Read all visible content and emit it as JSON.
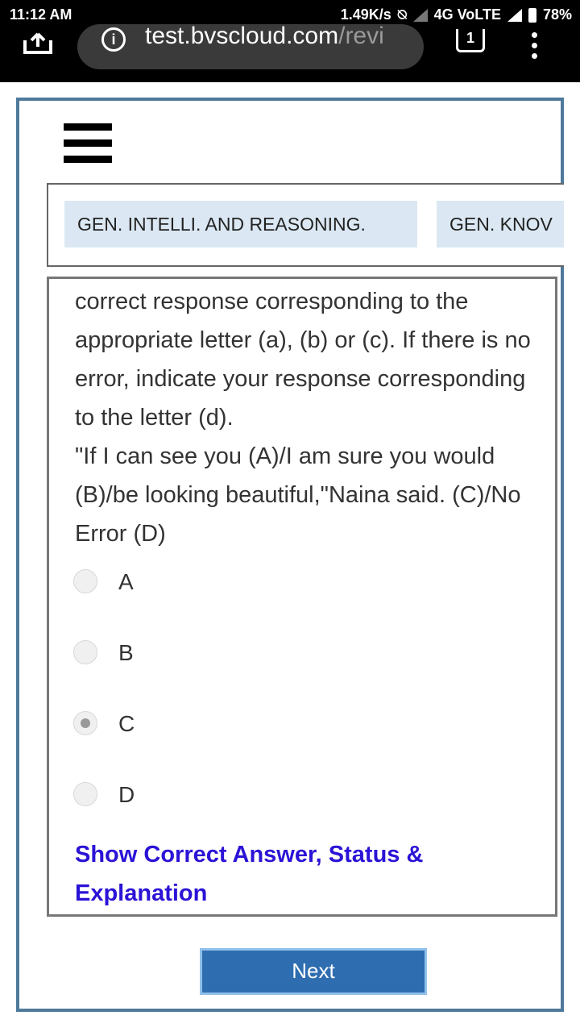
{
  "status_bar": {
    "time": "11:12 AM",
    "net_speed": "1.49K/s",
    "network": "4G VoLTE",
    "battery": "78%"
  },
  "browser": {
    "url_main": "test.bvscloud.com",
    "url_faded": "/revi",
    "tab_count": "1"
  },
  "section_tabs": [
    {
      "label": "GEN. INTELLI. AND REASONING."
    },
    {
      "label": "GEN. KNOV"
    }
  ],
  "question": {
    "text": "correct response corresponding to the appropriate letter (a), (b) or (c). If there is no error, indicate your response corresponding to the letter (d).\n\"If I can see you (A)/I am sure you would (B)/be looking beautiful,\"Naina said. (C)/No Error (D)",
    "options": [
      {
        "label": "A",
        "selected": false
      },
      {
        "label": "B",
        "selected": false
      },
      {
        "label": "C",
        "selected": true
      },
      {
        "label": "D",
        "selected": false
      }
    ],
    "show_answer_link": "Show Correct Answer, Status & Explanation"
  },
  "next_button": "Next",
  "colors": {
    "frame_border": "#4e7a9c",
    "tab_bg": "#dbe8f3",
    "link": "#2b13d6",
    "next_bg": "#2e6db0"
  }
}
